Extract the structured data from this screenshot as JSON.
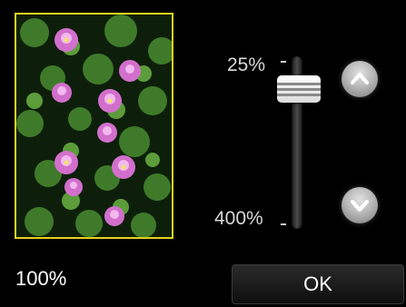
{
  "preview": {
    "image": "water-lily-flowers-photo",
    "frame_color": "#e0d21e"
  },
  "zoom": {
    "max_label": "25%",
    "min_label": "400%",
    "current_value": "100%"
  },
  "buttons": {
    "up_icon": "chevron-up-icon",
    "down_icon": "chevron-down-icon",
    "ok_label": "OK"
  }
}
